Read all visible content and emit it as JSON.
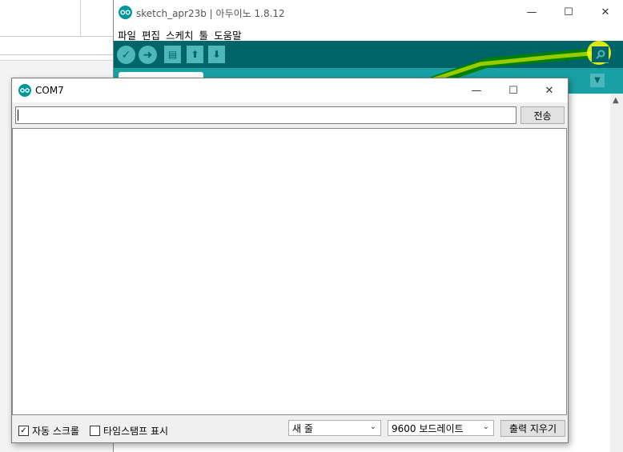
{
  "ide": {
    "title": "sketch_apr23b | 아두이노 1.8.12",
    "menu": [
      "파일",
      "편집",
      "스케치",
      "툴",
      "도움말"
    ],
    "toolbar_buttons": [
      "verify-icon",
      "upload-icon",
      "new-icon",
      "open-icon",
      "save-icon"
    ],
    "serial_monitor_icon": "magnifier-icon"
  },
  "window_controls": {
    "minimize": "—",
    "maximize": "☐",
    "close": "✕"
  },
  "serial_monitor": {
    "title": "COM7",
    "input_value": "",
    "send_label": "전송",
    "output_text": "",
    "autoscroll_label": "자동 스크롤",
    "autoscroll_checked": true,
    "timestamp_label": "타임스탬프 표시",
    "timestamp_checked": false,
    "line_ending": "새 줄",
    "baud_rate": "9600 보드레이트",
    "clear_label": "출력 지우기"
  },
  "colors": {
    "toolbar": "#006468",
    "tabbar": "#17a1a5",
    "button": "#4db7bb",
    "annotation": "#ffff00",
    "annotation_stroke": "#008000"
  }
}
